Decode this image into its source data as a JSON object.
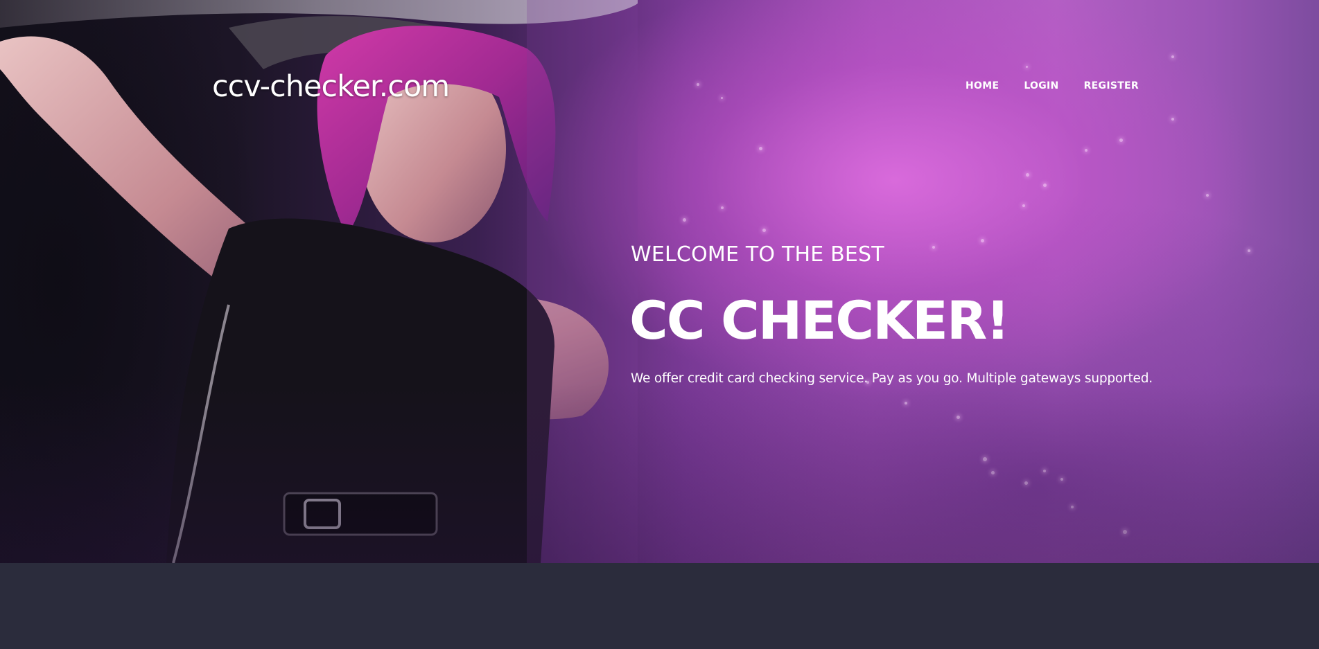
{
  "site": {
    "logo_text": "ccv-checker.com"
  },
  "nav": {
    "items": [
      {
        "label": "HOME"
      },
      {
        "label": "LOGIN"
      },
      {
        "label": "REGISTER"
      }
    ]
  },
  "hero": {
    "welcome": "WELCOME TO THE BEST",
    "headline": "CC CHECKER!",
    "subtitle": "We offer credit card checking service. Pay as you go. Multiple gateways supported."
  },
  "colors": {
    "accent": "#b35fc4",
    "footer_band": "#2b2c3c",
    "text": "#ffffff"
  }
}
